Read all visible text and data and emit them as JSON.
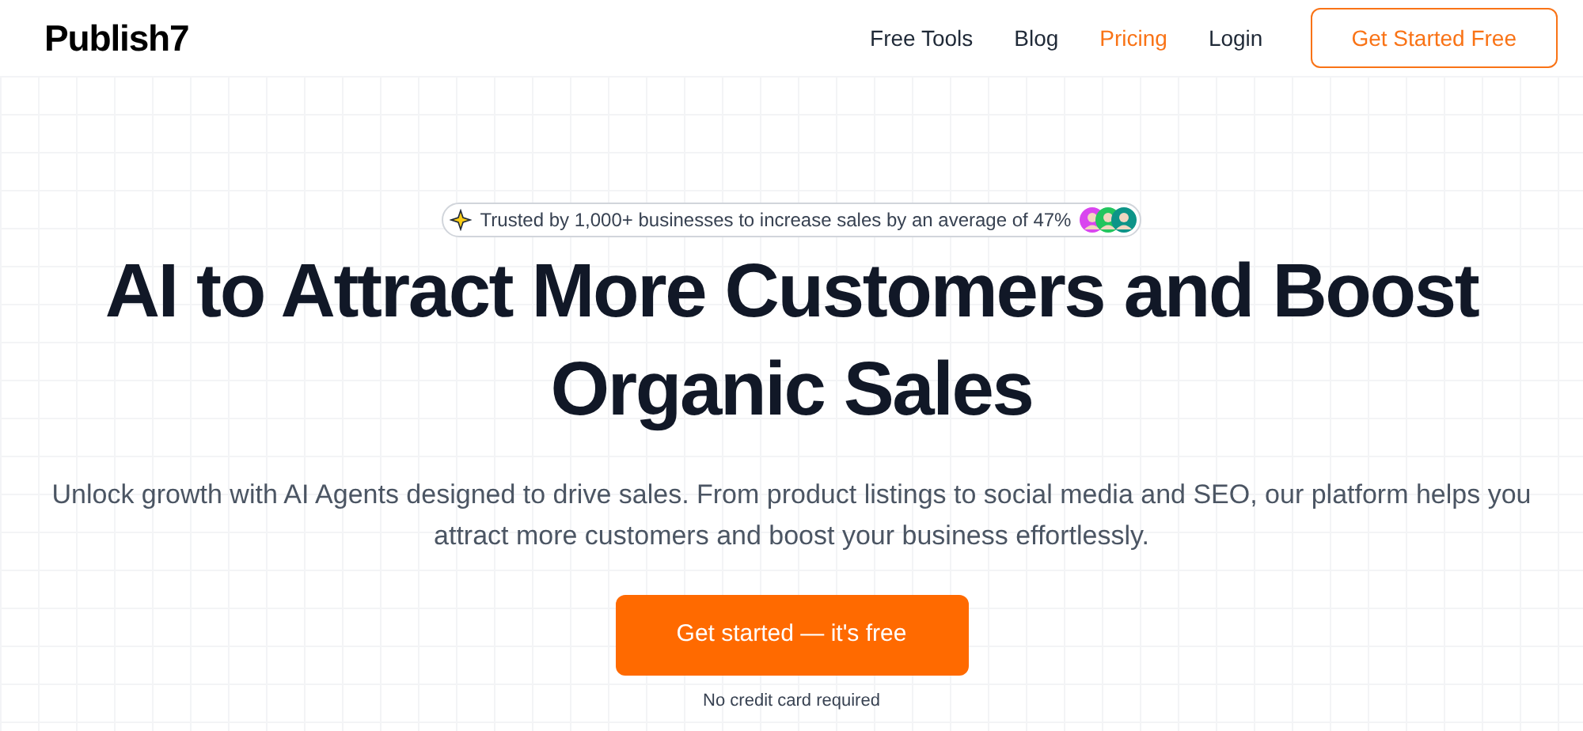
{
  "logo": "Publish7",
  "nav": [
    {
      "label": "Free Tools",
      "selected": false
    },
    {
      "label": "Blog",
      "selected": false
    },
    {
      "label": "Pricing",
      "selected": true
    },
    {
      "label": "Login",
      "selected": false
    }
  ],
  "header_button": "Get Started Free",
  "trust_badge": {
    "text": "Trusted by 1,000+ businesses to increase sales by an average of 47%",
    "avatars": [
      {
        "color": "#d946ef"
      },
      {
        "color": "#22c55e"
      },
      {
        "color": "#0d9488"
      }
    ]
  },
  "headline": "AI to Attract More Customers and Boost Organic Sales",
  "subheadline": "Unlock growth with AI Agents designed to drive sales. From product listings to social media and SEO, our platform helps you attract more customers and boost your business effortlessly.",
  "cta_button": "Get started — it's free",
  "cta_note": "No credit card required"
}
